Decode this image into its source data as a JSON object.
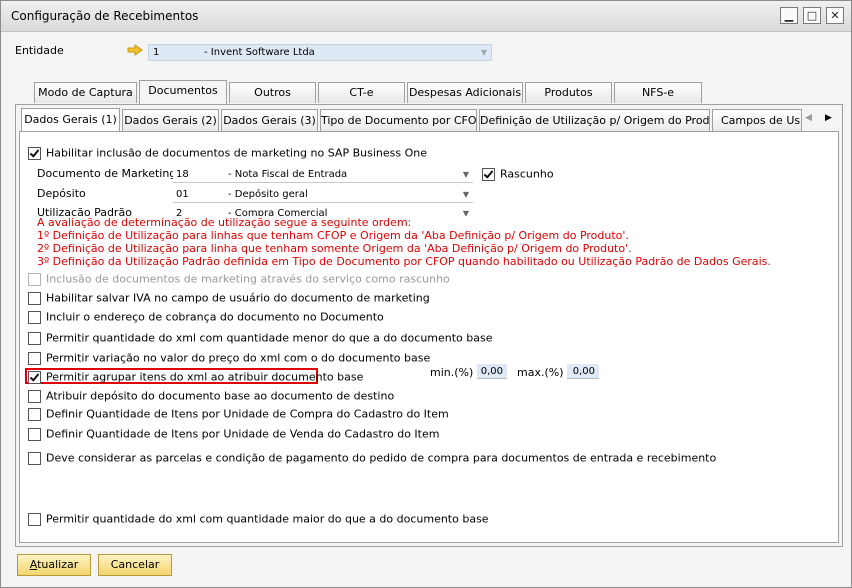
{
  "window": {
    "title": "Configuração de Recebimentos",
    "controls": {
      "minimize": "▁",
      "maximize": "□",
      "close": "✕"
    }
  },
  "entity": {
    "label": "Entidade",
    "code": "1",
    "name": "- Invent Software Ltda"
  },
  "tabs": [
    "Modo de Captura",
    "Documentos",
    "Outros",
    "CT-e",
    "Despesas Adicionais",
    "Produtos",
    "NFS-e"
  ],
  "subtabs": [
    "Dados Gerais (1)",
    "Dados Gerais (2)",
    "Dados Gerais (3)",
    "Tipo de Documento por CFOP",
    "Definição de Utilização p/ Origem do Produto",
    "Campos de Usuário"
  ],
  "subtab_nav": {
    "prev": "◀",
    "next": "▶"
  },
  "marketing": {
    "enable_label": "Habilitar inclusão de documentos de marketing no SAP Business One",
    "doc_label": "Documento de Marketing",
    "doc_code": "18",
    "doc_value": "- Nota Fiscal de Entrada",
    "draft_label": "Rascunho",
    "deposit_label": "Depósito",
    "deposit_code": "01",
    "deposit_value": "- Depósito geral",
    "usage_label": "Utilização Padrão",
    "usage_code": "2",
    "usage_value": "- Compra Comercial"
  },
  "notes": [
    "A avaliação de determinação de utilização segue a seguinte ordem:",
    "1º Definição de Utilização para linhas que tenham CFOP e Origem da 'Aba Definição p/ Origem do Produto'.",
    "2º Definição de Utilização para linha que tenham somente Origem da 'Aba Definição p/ Origem do Produto'.",
    "3º Definição da Utilização Padrão definida em Tipo de Documento por CFOP quando habilitado ou Utilização Padrão de Dados Gerais."
  ],
  "options": [
    "Inclusão de documentos de marketing através do serviço como rascunho",
    "Habilitar salvar IVA no campo de usuário do documento de marketing",
    "Incluir o endereço de cobrança do documento no Documento",
    "Permitir quantidade do xml com quantidade menor do que a do documento base",
    "Permitir variação no valor do preço do xml com o do documento base",
    "Permitir agrupar itens do xml ao atribuir documento base",
    "Atribuir depósito do documento base ao documento de destino",
    "Definir Quantidade de Itens por Unidade de Compra do Cadastro do Item",
    "Definir Quantidade de Itens por Unidade de Venda do Cadastro do Item",
    "Deve considerar as parcelas e condição de pagamento do pedido de compra para documentos de entrada e recebimento",
    "Permitir quantidade do xml com quantidade maior do que a do documento base"
  ],
  "tolerance": {
    "min_label": "min.(%)",
    "min_value": "0,00",
    "max_label": "max.(%)",
    "max_value": "0,00"
  },
  "buttons": {
    "update_first": "A",
    "update_rest": "tualizar",
    "cancel": "Cancelar"
  },
  "colors": {
    "accent_red": "#e00000",
    "input_blue": "#dfe9f5",
    "button_gold": "#f2d56d",
    "highlight_border": "#e00000"
  }
}
